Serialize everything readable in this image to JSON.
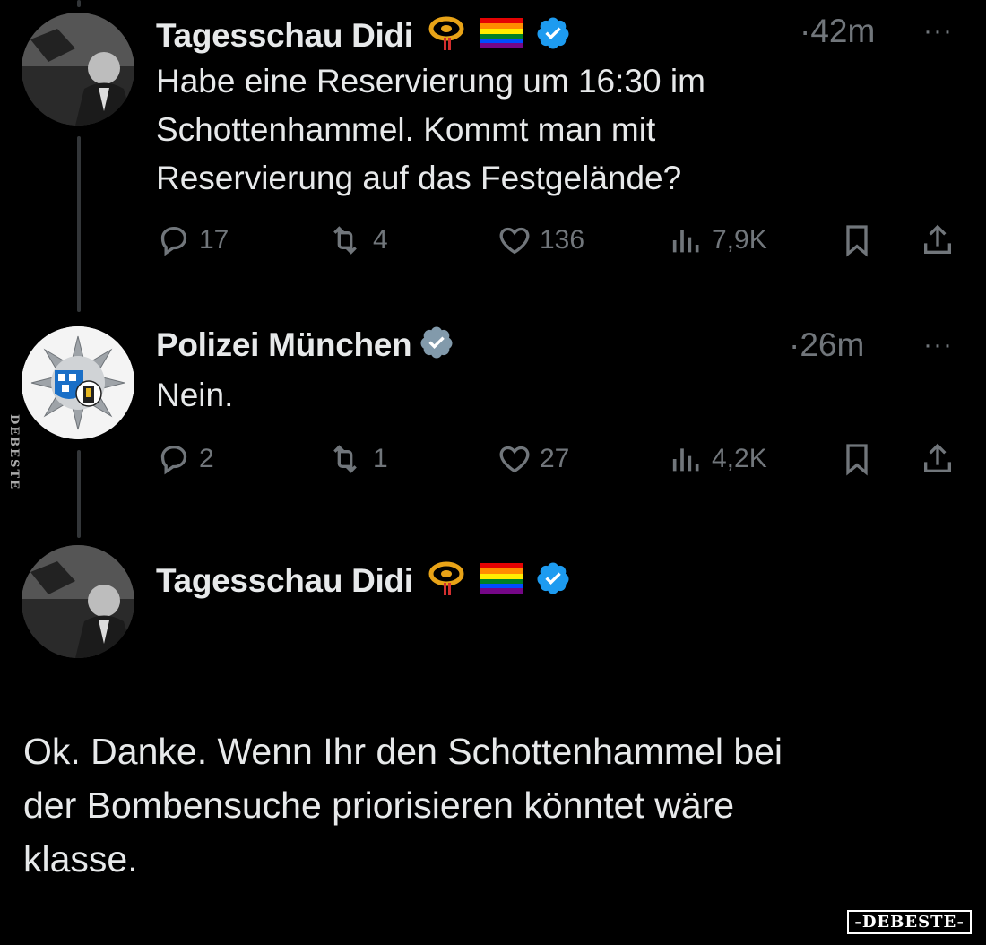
{
  "tweets": [
    {
      "author": "Tagesschau Didi",
      "emojis": [
        "postal-horn-emoji",
        "rainbow-flag-emoji"
      ],
      "verified": true,
      "time": "·42m",
      "text_lines": [
        "Habe eine Reservierung um 16:30 im",
        "Schottenhammel. Kommt man mit",
        "Reservierung auf das Festgelände?"
      ],
      "stats": {
        "replies": "17",
        "retweets": "4",
        "likes": "136",
        "views": "7,9K"
      }
    },
    {
      "author": "Polizei München",
      "verified": true,
      "time": "·26m",
      "text_lines": [
        "Nein."
      ],
      "stats": {
        "replies": "2",
        "retweets": "1",
        "likes": "27",
        "views": "4,2K"
      }
    },
    {
      "author": "Tagesschau Didi",
      "emojis": [
        "postal-horn-emoji",
        "rainbow-flag-emoji"
      ],
      "verified": true,
      "text_lines": [
        "Ok. Danke. Wenn Ihr den Schottenhammel bei",
        "der Bombensuche priorisieren könntet wäre",
        "klasse."
      ]
    }
  ],
  "more_label": "···",
  "watermark_side": "DEBESTE",
  "watermark": "-DEBESTE-",
  "colors": {
    "background": "#000000",
    "text": "#e7e9ea",
    "muted": "#71767b",
    "verified": "#1d9bf0"
  }
}
